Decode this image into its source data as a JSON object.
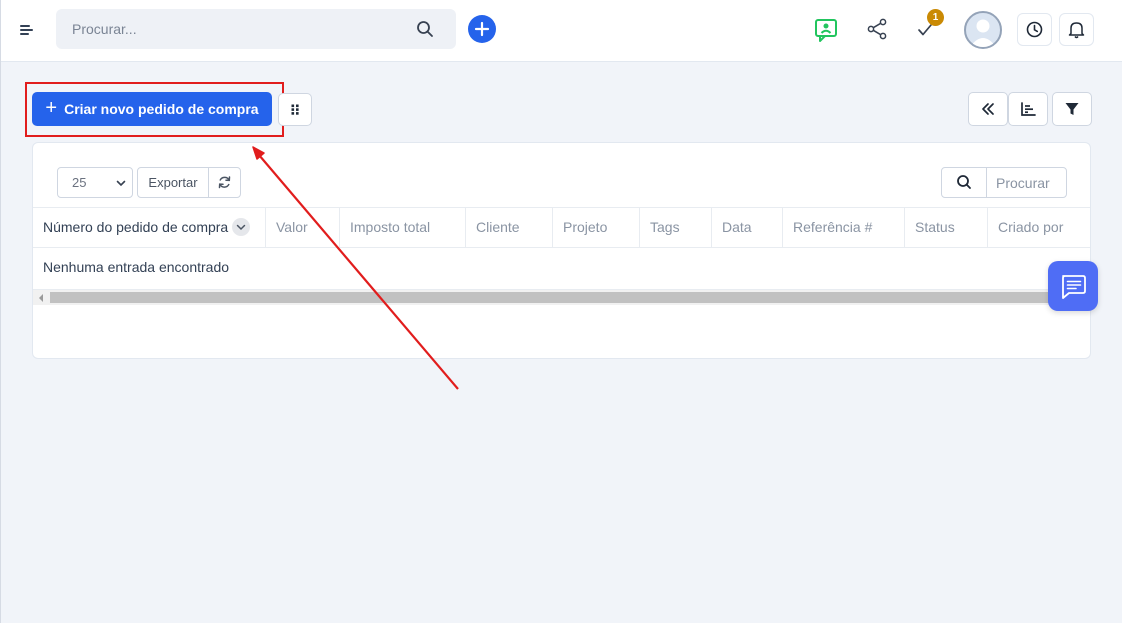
{
  "topbar": {
    "search_placeholder": "Procurar...",
    "tasks_badge": "1",
    "icons": {
      "menu": "hamburger-menu-icon",
      "search": "search-icon",
      "add": "plus-circle-icon",
      "support": "support-chat-icon",
      "share": "share-icon",
      "tasks": "checkmark-icon",
      "avatar": "user-avatar",
      "clock": "clock-icon",
      "notifications": "bell-icon"
    }
  },
  "toolbar": {
    "create_label": "Criar novo pedido de compra",
    "icons": [
      "grid-dots-icon",
      "double-chevron-left-icon",
      "bar-chart-icon",
      "filter-icon"
    ]
  },
  "table": {
    "page_size": "25",
    "export_label": "Exportar",
    "search_placeholder": "Procurar",
    "columns": [
      "Número do pedido de compra",
      "Valor",
      "Imposto total",
      "Cliente",
      "Projeto",
      "Tags",
      "Data",
      "Referência #",
      "Status",
      "Criado por"
    ],
    "empty_message": "Nenhuma entrada encontrado"
  },
  "colors": {
    "primary": "#2563eb",
    "highlight": "#e11d1d",
    "badge": "#ca8a04",
    "support_green": "#22c55e",
    "chat_fab": "#4f6df5"
  }
}
